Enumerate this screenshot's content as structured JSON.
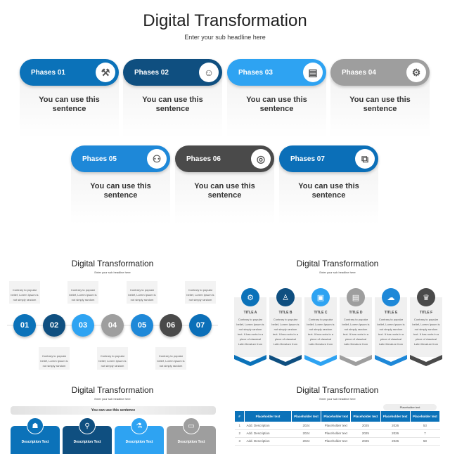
{
  "main": {
    "title": "Digital Transformation",
    "subtitle": "Enter your sub headline here",
    "phases": [
      {
        "label": "Phases 01",
        "text": "You can use this sentence",
        "color": "#0b72b9",
        "icon": "worker-icon"
      },
      {
        "label": "Phases 02",
        "text": "You can use this sentence",
        "color": "#0f4f80",
        "icon": "engineer-icon"
      },
      {
        "label": "Phases 03",
        "text": "You can use this sentence",
        "color": "#2ea3f2",
        "icon": "book-icon"
      },
      {
        "label": "Phases 04",
        "text": "You can use this sentence",
        "color": "#9e9e9e",
        "icon": "toolbox-icon"
      },
      {
        "label": "Phases 05",
        "text": "You can use this sentence",
        "color": "#1e88d8",
        "icon": "robot-icon"
      },
      {
        "label": "Phases 06",
        "text": "You can use this sentence",
        "color": "#4a4a4a",
        "icon": "fingerprint-icon"
      },
      {
        "label": "Phases 07",
        "text": "You can use this sentence",
        "color": "#0b6fb8",
        "icon": "puzzle-icon"
      }
    ]
  },
  "thumb1": {
    "title": "Digital Transformation",
    "subtitle": "Enter your sub headline here",
    "steps": [
      "01",
      "02",
      "03",
      "04",
      "05",
      "06",
      "07"
    ],
    "note": "Contrary to popular belief, Lorem Ipsum is not simply random"
  },
  "thumb2": {
    "title": "Digital Transformation",
    "subtitle": "Enter your sub headline here",
    "titles": [
      "TITLE A",
      "TITLE B",
      "TITLE C",
      "TITLE D",
      "TITLE E",
      "TITLE F"
    ],
    "text": "Contrary to popular belief, Lorem Ipsum is not simply random text. It has roots in a piece of classical Latin literature from"
  },
  "thumb3": {
    "title": "Digital Transformation",
    "subtitle": "Enter your sub headline here",
    "bar": "You can use this sentence",
    "cards": [
      "Description Text",
      "Description Text",
      "Description Text",
      "Description Text"
    ]
  },
  "thumb4": {
    "title": "Digital Transformation",
    "subtitle": "Enter your sub headline here",
    "pill": "Placeholder text",
    "headers": [
      "#",
      "Placeholder text",
      "Placeholder text",
      "Placeholder text",
      "Placeholder text",
      "Placeholder text",
      "Placeholder text"
    ],
    "rows": [
      [
        "1",
        "Add. Description",
        "2024",
        "Placeholder text",
        "2025",
        "2026",
        "53"
      ],
      [
        "2",
        "Add. Description",
        "2024",
        "Placeholder text",
        "2025",
        "2026",
        "7"
      ],
      [
        "3",
        "Add. Description",
        "2024",
        "Placeholder text",
        "2025",
        "2026",
        "58"
      ]
    ]
  }
}
